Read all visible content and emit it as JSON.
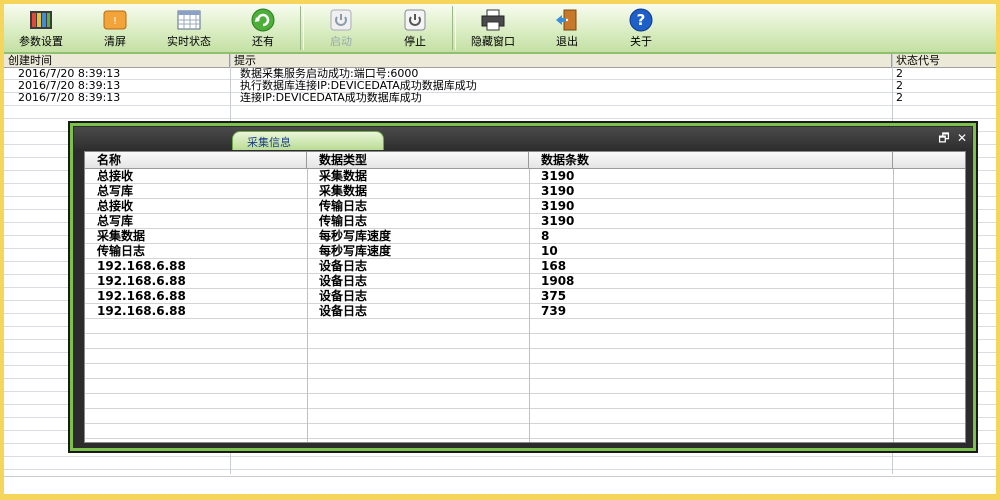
{
  "toolbar": {
    "buttons": [
      {
        "label": "参数设置",
        "icon": "books-icon",
        "disabled": false
      },
      {
        "label": "清屏",
        "icon": "clear-screen-icon",
        "disabled": false
      },
      {
        "label": "实时状态",
        "icon": "calendar-grid-icon",
        "disabled": false
      },
      {
        "label": "还有",
        "icon": "refresh-icon",
        "disabled": false
      },
      {
        "label": "启动",
        "icon": "power-icon",
        "disabled": true
      },
      {
        "label": "停止",
        "icon": "power-icon",
        "disabled": false
      },
      {
        "label": "隐藏窗口",
        "icon": "printer-icon",
        "disabled": false
      },
      {
        "label": "退出",
        "icon": "exit-door-icon",
        "disabled": false
      },
      {
        "label": "关于",
        "icon": "help-icon",
        "disabled": false
      }
    ]
  },
  "log": {
    "headers": {
      "time": "创建时间",
      "tip": "提示",
      "code": "状态代号"
    },
    "rows": [
      {
        "time": "2016/7/20 8:39:13",
        "tip": "数据采集服务启动成功:端口号:6000",
        "code": "2"
      },
      {
        "time": "2016/7/20 8:39:13",
        "tip": "执行数据库连接IP:DEVICEDATA成功数据库成功",
        "code": "2"
      },
      {
        "time": "2016/7/20 8:39:13",
        "tip": "连接IP:DEVICEDATA成功数据库成功",
        "code": "2"
      }
    ]
  },
  "dialog": {
    "title": "采集信息",
    "restore_glyph": "🗗",
    "close_glyph": "✕",
    "headers": {
      "name": "名称",
      "type": "数据类型",
      "count": "数据条数"
    },
    "rows": [
      {
        "name": "总接收",
        "type": "采集数据",
        "count": "3190"
      },
      {
        "name": "总写库",
        "type": "采集数据",
        "count": "3190"
      },
      {
        "name": "总接收",
        "type": "传输日志",
        "count": "3190"
      },
      {
        "name": "总写库",
        "type": "传输日志",
        "count": "3190"
      },
      {
        "name": "采集数据",
        "type": "每秒写库速度",
        "count": "8"
      },
      {
        "name": "传输日志",
        "type": "每秒写库速度",
        "count": "10"
      },
      {
        "name": "192.168.6.88",
        "type": "设备日志",
        "count": "168"
      },
      {
        "name": "192.168.6.88",
        "type": "设备日志",
        "count": "1908"
      },
      {
        "name": "192.168.6.88",
        "type": "设备日志",
        "count": "375"
      },
      {
        "name": "192.168.6.88",
        "type": "设备日志",
        "count": "739"
      }
    ]
  },
  "colors": {
    "accent_green": "#7cc24a",
    "frame_yellow": "#f5d65a",
    "title_blue": "#1a3d8a"
  }
}
